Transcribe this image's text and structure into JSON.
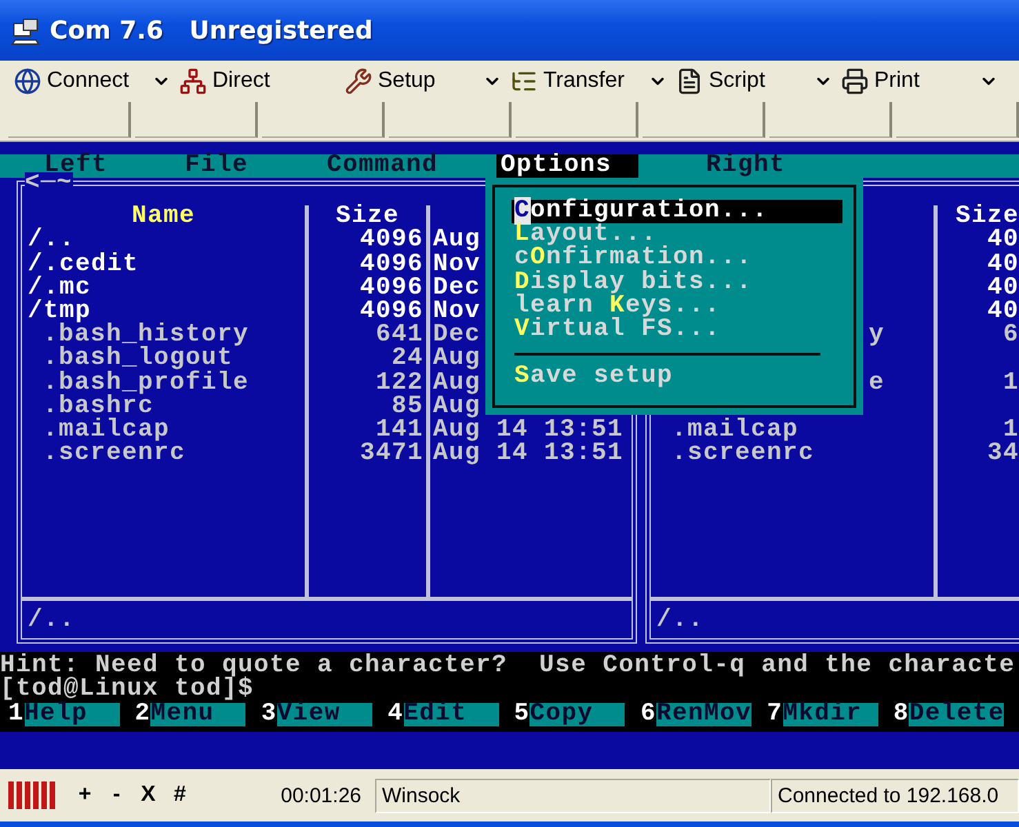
{
  "window": {
    "title": "Com 7.6   Unregistered"
  },
  "toolbar": [
    {
      "label": "Connect",
      "dropdown": true
    },
    {
      "label": "Direct",
      "dropdown": false
    },
    {
      "label": "Setup",
      "dropdown": true
    },
    {
      "label": "Transfer",
      "dropdown": true
    },
    {
      "label": "Script",
      "dropdown": true
    },
    {
      "label": "Print",
      "dropdown": true
    }
  ],
  "terminal": {
    "menu_bar": [
      {
        "label": "Left",
        "selected": false
      },
      {
        "label": "File",
        "selected": false
      },
      {
        "label": "Command",
        "selected": false
      },
      {
        "label": "Options",
        "selected": true
      },
      {
        "label": "Right",
        "selected": false
      }
    ],
    "options_menu": [
      {
        "kind": "item",
        "key": "C",
        "after": "onfiguration...",
        "selected": true
      },
      {
        "kind": "item",
        "key": "L",
        "after": "ayout...",
        "selected": false
      },
      {
        "kind": "item",
        "before": "c",
        "key": "O",
        "after": "nfirmation...",
        "selected": false
      },
      {
        "kind": "item",
        "key": "D",
        "after": "isplay bits...",
        "selected": false
      },
      {
        "kind": "item",
        "before": "learn ",
        "key": "K",
        "after": "eys...",
        "selected": false
      },
      {
        "kind": "item",
        "key": "V",
        "after": "irtual FS...",
        "selected": false
      },
      {
        "kind": "separator"
      },
      {
        "kind": "item",
        "key": "S",
        "after": "ave setup",
        "selected": false
      }
    ],
    "left_panel": {
      "path": "<─~",
      "header": {
        "name": "Name",
        "size": "Size"
      },
      "rows": [
        {
          "kind": "dir",
          "name": "/..",
          "size": "4096",
          "date": "Aug"
        },
        {
          "kind": "dir",
          "name": "/.cedit",
          "size": "4096",
          "date": "Nov"
        },
        {
          "kind": "dir",
          "name": "/.mc",
          "size": "4096",
          "date": "Dec"
        },
        {
          "kind": "dir",
          "name": "/tmp",
          "size": "4096",
          "date": "Nov"
        },
        {
          "kind": "file",
          "name": ".bash_history",
          "size": "641",
          "date": "Dec"
        },
        {
          "kind": "file",
          "name": ".bash_logout",
          "size": "24",
          "date": "Aug"
        },
        {
          "kind": "file",
          "name": ".bash_profile",
          "size": "122",
          "date": "Aug"
        },
        {
          "kind": "file",
          "name": ".bashrc",
          "size": "85",
          "date": "Aug"
        },
        {
          "kind": "file",
          "name": ".mailcap",
          "size": "141",
          "date": "Aug 14 13:51"
        },
        {
          "kind": "file",
          "name": ".screenrc",
          "size": "3471",
          "date": "Aug 14 13:51"
        }
      ],
      "status": "/.."
    },
    "right_panel": {
      "header": {
        "size": "Size"
      },
      "rows": [
        {
          "kind": "dir",
          "size": "40"
        },
        {
          "kind": "dir",
          "size": "40"
        },
        {
          "kind": "dir",
          "size": "40"
        },
        {
          "kind": "dir",
          "size": "40"
        },
        {
          "kind": "file",
          "name": "y",
          "tail": true,
          "size": "6"
        },
        {
          "kind": "file"
        },
        {
          "kind": "file",
          "name": "e",
          "tail": true,
          "size": "1"
        },
        {
          "kind": "file"
        },
        {
          "kind": "file",
          "name": ".mailcap",
          "tail": false,
          "size": "1"
        },
        {
          "kind": "file",
          "name": ".screenrc",
          "tail": false,
          "size": "34"
        }
      ],
      "status": "/.."
    },
    "hint": "Hint: Need to quote a character?  Use Control-q and the characte",
    "prompt": "[tod@Linux tod]$",
    "function_keys": [
      {
        "number": "1",
        "label": "Help"
      },
      {
        "number": "2",
        "label": "Menu"
      },
      {
        "number": "3",
        "label": "View"
      },
      {
        "number": "4",
        "label": "Edit"
      },
      {
        "number": "5",
        "label": "Copy"
      },
      {
        "number": "6",
        "label": "RenMov"
      },
      {
        "number": "7",
        "label": "Mkdir"
      },
      {
        "number": "8",
        "label": "Delete"
      }
    ]
  },
  "status_bar": {
    "controls": [
      "+",
      "-",
      "X",
      "#"
    ],
    "timer": "00:01:26",
    "protocol": "Winsock",
    "connection": "Connected to 192.168.0"
  }
}
